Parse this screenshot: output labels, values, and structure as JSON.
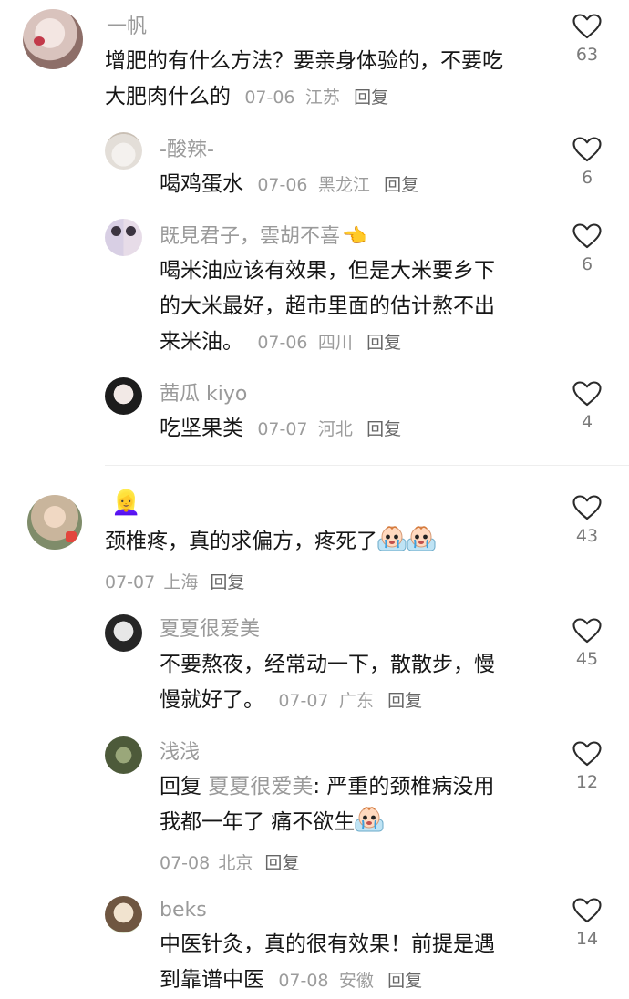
{
  "comments": [
    {
      "username": "一帆",
      "text": "增肥的有什么方法？要亲身体验的，不要吃大肥肉什么的",
      "text_line1": "增肥的有什么方法？要亲身体验的，不要吃",
      "text_line2": "大肥肉什么的",
      "date": "07-06",
      "location": "江苏",
      "reply_label": "回复",
      "likes": "63",
      "replies": [
        {
          "username": "-酸辣-",
          "text": "喝鸡蛋水",
          "date": "07-06",
          "location": "黑龙江",
          "reply_label": "回复",
          "likes": "6"
        },
        {
          "username": "既見君子，雲胡不喜👈",
          "username_text": "既見君子，雲胡不喜",
          "username_emoji": "👈",
          "text": "喝米油应该有效果，但是大米要乡下的大米最好，超市里面的估计熬不出来米油。",
          "text_line1": "喝米油应该有效果，但是大米要乡下",
          "text_line2": "的大米最好，超市里面的估计熬不出",
          "text_line3": "来米油。",
          "date": "07-06",
          "location": "四川",
          "reply_label": "回复",
          "likes": "6"
        },
        {
          "username": "茜瓜 kiyo",
          "text": "吃坚果类",
          "date": "07-07",
          "location": "河北",
          "reply_label": "回复",
          "likes": "4"
        }
      ]
    },
    {
      "username_emoji": "👱‍♀️",
      "text": "颈椎疼，真的求偏方，疼死了",
      "date": "07-07",
      "location": "上海",
      "reply_label": "回复",
      "likes": "43",
      "replies": [
        {
          "username": "夏夏很爱美",
          "text_line1": "不要熬夜，经常动一下，散散步，慢",
          "text_line2": "慢就好了。",
          "date": "07-07",
          "location": "广东",
          "reply_label": "回复",
          "likes": "45"
        },
        {
          "username": "浅浅",
          "reply_prefix": "回复",
          "reply_to": "夏夏很爱美",
          "text_line1": ": 严重的颈椎病没用",
          "text_line2": "我都一年了 痛不欲生",
          "date": "07-08",
          "location": "北京",
          "reply_label": "回复",
          "likes": "12"
        },
        {
          "username": "beks",
          "text_line1": "中医针灸，真的很有效果！前提是遇",
          "text_line2": "到靠谱中医",
          "date": "07-08",
          "location": "安徽",
          "reply_label": "回复",
          "likes": "14"
        }
      ]
    }
  ],
  "icons": {
    "like": "heart-outline-icon",
    "sticker": "crying-baby-sticker"
  },
  "colors": {
    "text": "#161616",
    "meta": "#9c9c9c",
    "name": "#9a9a9a",
    "divider": "#eeeeee"
  }
}
